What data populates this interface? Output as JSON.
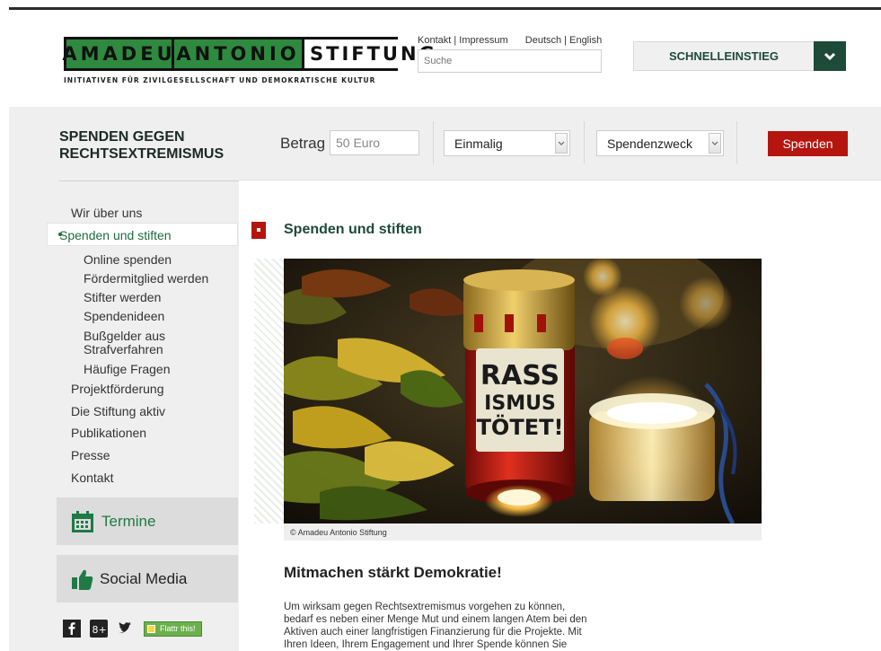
{
  "logo": {
    "word1": "AMADEU",
    "word2": "ANTONIO",
    "word3": "STIFTUNG",
    "tagline": "INITIATIVEN FÜR ZIVILGESELLSCHAFT UND DEMOKRATISCHE KULTUR"
  },
  "header": {
    "links": [
      "Kontakt",
      "Impressum"
    ],
    "languages": [
      "Deutsch",
      "English"
    ],
    "separator": " | ",
    "search_placeholder": "Suche",
    "quick_access": "SCHNELLEINSTIEG"
  },
  "donation": {
    "title_line1": "SPENDEN GEGEN",
    "title_line2": "RECHTSEXTREMISMUS",
    "amount_label": "Betrag",
    "amount_value": "50 Euro",
    "frequency": "Einmalig",
    "purpose": "Spendenzweck",
    "submit": "Spenden"
  },
  "nav": {
    "items": [
      "Wir über uns",
      "Spenden und stiften",
      "Projektförderung",
      "Die Stiftung aktiv",
      "Publikationen",
      "Presse",
      "Kontakt"
    ],
    "subitems": [
      "Online spenden",
      "Fördermitglied werden",
      "Stifter werden",
      "Spendenideen",
      "Bußgelder aus",
      "Strafverfahren",
      "Häufige Fragen"
    ],
    "termine": "Termine",
    "social": "Social Media",
    "flattr": "Flattr this!"
  },
  "main": {
    "title": "Spenden und stiften",
    "caption": "© Amadeu Antonio Stiftung",
    "candle_text": [
      "RASS",
      "ISMUS",
      "TÖTET!"
    ],
    "heading": "Mitmachen stärkt Demokratie!",
    "paragraph": [
      "Um wirksam gegen Rechtsextremismus vorgehen zu können,",
      "bedarf es neben einer Menge Mut und einem langen Atem bei den",
      "Aktiven auch einer langfristigen Finanzierung für die Projekte. Mit",
      "Ihren Ideen, Ihrem Engagement und Ihrer Spende können Sie"
    ]
  },
  "colors": {
    "brand_green": "#2e8a3e",
    "dark_green": "#1e4a3a",
    "accent_red": "#b5150f"
  },
  "icons": [
    "chevron-down-icon",
    "calendar-icon",
    "thumbs-up-icon",
    "facebook-icon",
    "google-plus-icon",
    "twitter-icon",
    "flattr-icon"
  ]
}
